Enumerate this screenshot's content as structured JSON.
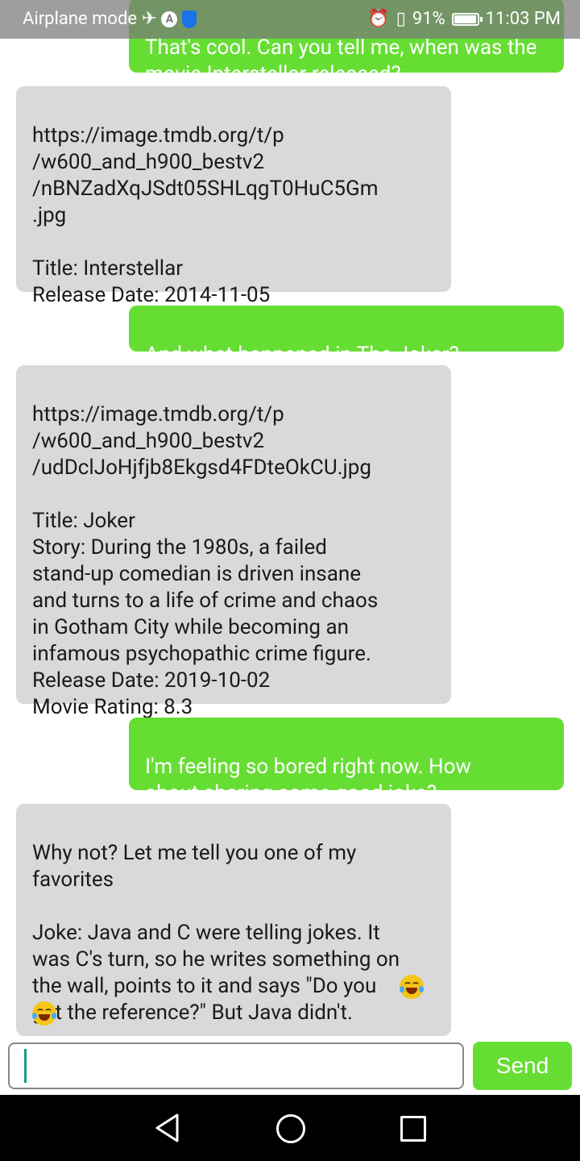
{
  "status_bar": {
    "left_text": "Airplane mode",
    "battery": "91%",
    "time": "11:03 PM"
  },
  "messages": [
    {
      "side": "sent",
      "text": "That's cool. Can you tell me, when was the movie Interstellar released?"
    },
    {
      "side": "recv",
      "text": "https://image.tmdb.org/t/p\n/w600_and_h900_bestv2\n/nBNZadXqJSdt05SHLqgT0HuC5Gm\n.jpg\n\nTitle: Interstellar\nRelease Date: 2014-11-05"
    },
    {
      "side": "sent",
      "text": "And what happened in The Joker?"
    },
    {
      "side": "recv",
      "text": "https://image.tmdb.org/t/p\n/w600_and_h900_bestv2\n/udDclJoHjfjb8Ekgsd4FDteOkCU.jpg\n\nTitle: Joker\nStory: During the 1980s, a failed\nstand-up comedian is driven insane\nand turns to a life of crime and chaos\nin Gotham City while becoming an\ninfamous psychopathic crime figure.\nRelease Date: 2019-10-02\nMovie Rating: 8.3"
    },
    {
      "side": "sent",
      "text": "I'm feeling so bored right now. How\nabout sharing some good joke?"
    },
    {
      "side": "recv",
      "text": "Why not? Let me tell you one of my\nfavorites\n\nJoke: Java and C were telling jokes. It\nwas C's turn, so he writes something on\nthe wall, points to it and says \"Do you\nget the reference?\" But Java didn't.",
      "emoji": "face-with-tears-of-joy"
    }
  ],
  "composer": {
    "input_value": "",
    "send_label": "Send"
  },
  "colors": {
    "sent_bubble": "#66dd33",
    "received_bubble": "#d9d9d9",
    "send_button": "#66dd33"
  }
}
